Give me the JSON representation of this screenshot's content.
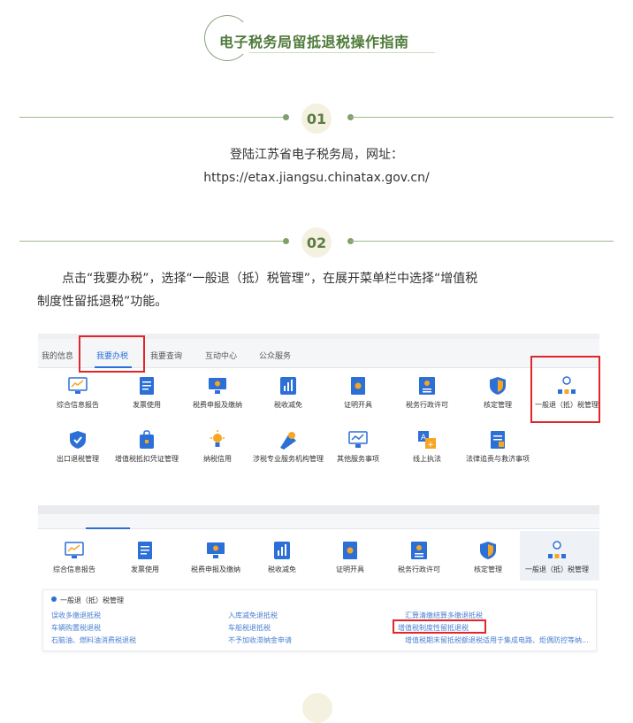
{
  "title": "电子税务局留抵退税操作指南",
  "steps": [
    {
      "num": "01",
      "lines": [
        "登陆江苏省电子税务局，网址：",
        "https://etax.jiangsu.chinatax.gov.cn/"
      ]
    },
    {
      "num": "02",
      "lines": [
        "点击“我要办税”，选择“一般退（抵）税管理”，在展开菜单栏中选择“增值税",
        "制度性留抵退税”功能。"
      ]
    }
  ],
  "tabs": [
    "我的信息",
    "我要办税",
    "我要查询",
    "互动中心",
    "公众服务"
  ],
  "row1": [
    "综合信息报告",
    "发票使用",
    "税费申报及缴纳",
    "税收减免",
    "证明开具",
    "税务行政许可",
    "核定管理",
    "一般退（抵）税管理"
  ],
  "row2": [
    "出口退税管理",
    "增值税抵扣凭证管理",
    "纳税信用",
    "涉税专业服务机构管理",
    "其他服务事项",
    "线上执法",
    "法律追责与救济事项"
  ],
  "row3": [
    "综合信息报告",
    "发票使用",
    "税费申报及缴纳",
    "税收减免",
    "证明开具",
    "税务行政许可",
    "核定管理",
    "一般退（抵）税管理"
  ],
  "submenu": {
    "title": "一般退（抵）税管理",
    "col1": [
      "误收多缴退抵税",
      "车辆购置税退税",
      "石脑油、燃料油消费税退税"
    ],
    "col2": [
      "入库减免退抵税",
      "车船税退抵税",
      "不予加收滞纳金申请"
    ],
    "col3": [
      "汇算清缴结算多缴退抵税",
      "增值税制度性留抵退税",
      "增值税期末留抵税额退税适用于集成电路、炬偶防控等纳..."
    ]
  },
  "colors": {
    "accent": "#4f7a3a",
    "link": "#4a7fd0",
    "highlight": "#e0262c",
    "tab_active": "#2c6fd6"
  }
}
